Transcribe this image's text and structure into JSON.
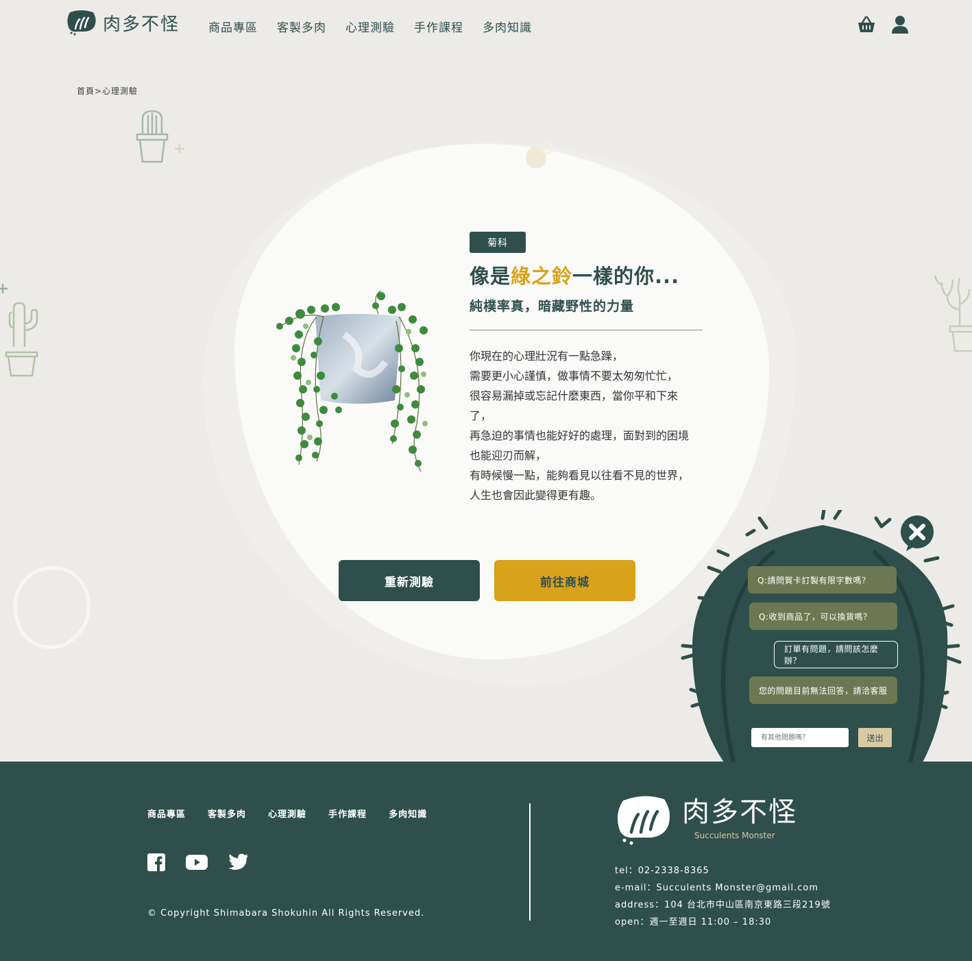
{
  "header": {
    "logo_text": "肉多不怪",
    "nav": [
      "商品專區",
      "客製多肉",
      "心理測驗",
      "手作課程",
      "多肉知識"
    ],
    "icons": [
      "basket-icon",
      "user-icon"
    ]
  },
  "breadcrumb": "首頁>心理測驗",
  "result": {
    "tag": "菊科",
    "title_prefix": "像是",
    "title_highlight": "綠之鈴",
    "title_suffix": "一樣的你...",
    "subtitle": "純樸率真，暗藏野性的力量",
    "body_lines": [
      "你現在的心理壯況有一點急躁，",
      "需要更小心謹慎，做事情不要太匆匆忙忙，",
      "很容易漏掉或忘記什麼東西，當你平和下來",
      "了，",
      "再急迫的事情也能好好的處理，面對到的困境",
      "也能迎刃而解，",
      "有時候慢一點，能夠看見以往看不見的世界，",
      "人生也會因此變得更有趣。"
    ]
  },
  "buttons": {
    "retry": "重新測驗",
    "shop": "前往商城"
  },
  "chat": {
    "questions": [
      "Q:請問賀卡訂製有限字數嗎？",
      "Q:收到商品了，可以換貨嗎？",
      "訂單有問題，請問該怎麼辦？",
      "您的問題目前無法回答，請洽客服"
    ],
    "input_placeholder": "有其他問題嗎？",
    "send_label": "送出"
  },
  "footer": {
    "nav": [
      "商品專區",
      "客製多肉",
      "心理測驗",
      "手作課程",
      "多肉知識"
    ],
    "social": [
      "facebook-icon",
      "youtube-icon",
      "twitter-icon"
    ],
    "copyright": "© Copyright Shimabara Shokuhin All Rights Reserved.",
    "logo_cn": "肉多不怪",
    "logo_en": "Succulents Monster",
    "tel": "tel：02-2338-8365",
    "email": "e-mail：Succulents Monster@gmail.com",
    "address": "address：104 台北市中山區南京東路三段219號",
    "open": "open：週一至週日 11:00 – 18:30"
  },
  "colors": {
    "primary": "#2e4f4b",
    "accent": "#d9a21b",
    "olive": "#6d7852",
    "background": "#ecebe8"
  }
}
